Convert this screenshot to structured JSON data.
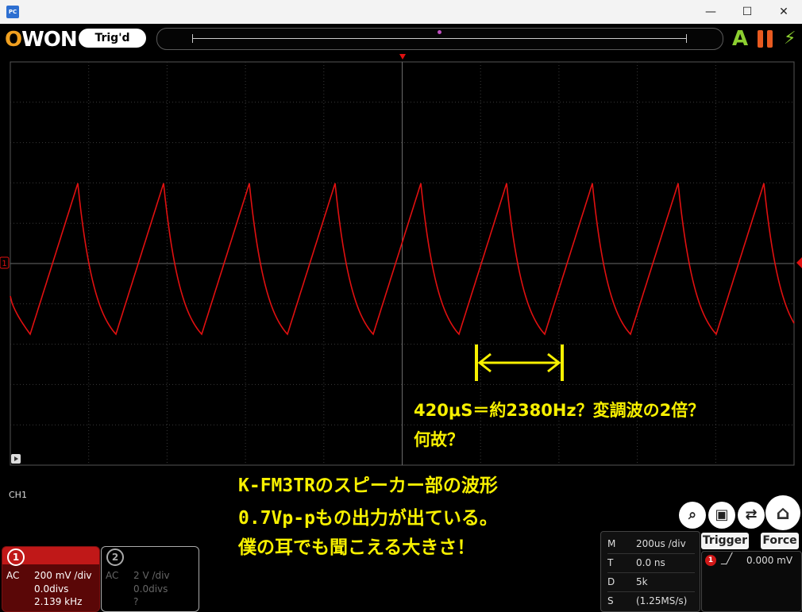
{
  "window": {
    "app_icon": "PC",
    "minimize_icon": "—",
    "maximize_icon": "☐",
    "close_icon": "✕"
  },
  "toolbar": {
    "logo_o": "O",
    "logo_rest": "WON",
    "trigger_status": "Trig'd",
    "auto_icon": "A",
    "bolt_icon": "⚡"
  },
  "annotation": {
    "line1": "420μS＝約2380Hz？変調波の2倍？",
    "line2": "何故？"
  },
  "caption": {
    "line1": "K-FM3TRのスピーカー部の波形",
    "line2": "0.7Vp-pもの出力が出ている。",
    "line3": "僕の耳でも聞こえる大きさ！"
  },
  "scope": {
    "trace_color": "#e01010",
    "channel_marker": "1",
    "grid_color": "#3a3a3a",
    "annotation_color": "#f7f000"
  },
  "ch1": {
    "label": "CH1",
    "number": "1",
    "coupling": "AC",
    "volts_div": "200 mV /div",
    "offset": "0.0divs",
    "frequency": "2.139 kHz"
  },
  "ch2": {
    "number": "2",
    "coupling": "AC",
    "volts_div": "2 V /div",
    "offset": "0.0divs",
    "frequency": "?"
  },
  "horizontal": {
    "m_key": "M",
    "m_value": "200us /div",
    "t_key": "T",
    "t_value": "0.0 ns",
    "d_key": "D",
    "d_value": "5k",
    "s_key": "S",
    "s_value": "(1.25MS/s)"
  },
  "trigger": {
    "button": "Trigger",
    "force": "Force",
    "channel": "1",
    "edge_icon": "_╱",
    "level": "0.000 mV"
  },
  "tools": {
    "zoom_icon": "⌕",
    "save_icon": "▣",
    "swap_icon": "⇄",
    "home_icon": "⌂"
  }
}
